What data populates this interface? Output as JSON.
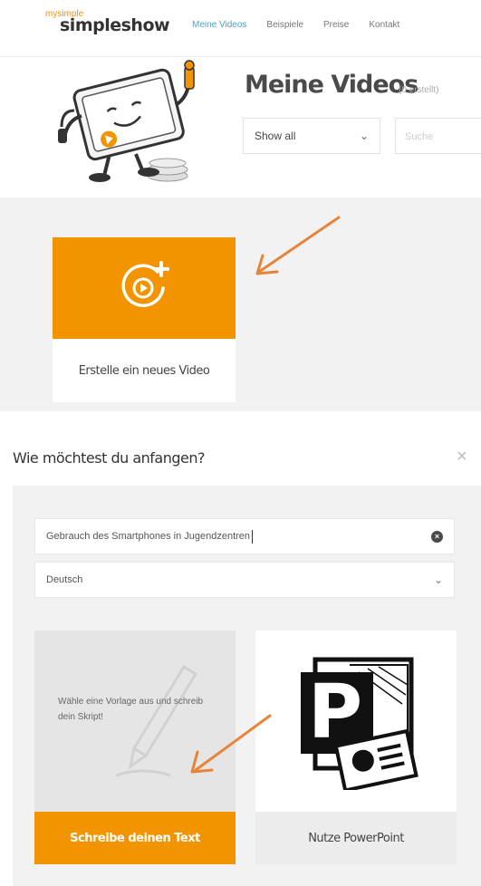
{
  "header": {
    "brand_prefix": "mysimple",
    "brand_name": "simpleshow",
    "nav": [
      "Meine Videos",
      "Beispiele",
      "Preise",
      "Kontakt"
    ],
    "active_nav": "Meine Videos"
  },
  "page": {
    "title": "Meine Videos",
    "count_text": "(0 erstellt)",
    "filter_value": "Show all",
    "search_placeholder": "Suche"
  },
  "create_card": {
    "label": "Erstelle ein neues Video"
  },
  "dialog": {
    "title": "Wie möchtest du anfangen?",
    "close_symbol": "×",
    "topic_value": "Gebrauch des Smartphones in Jugendzentren",
    "language_value": "Deutsch",
    "options": {
      "text": {
        "description": "Wähle eine Vorlage aus und schreib dein Skript!",
        "button": "Schreibe deinen Text"
      },
      "powerpoint": {
        "button": "Nutze PowerPoint"
      }
    }
  },
  "colors": {
    "accent": "#f29400",
    "arrow": "#e8843a",
    "gray_bg": "#f2f2f2",
    "nav_active": "#4ba3c7"
  }
}
